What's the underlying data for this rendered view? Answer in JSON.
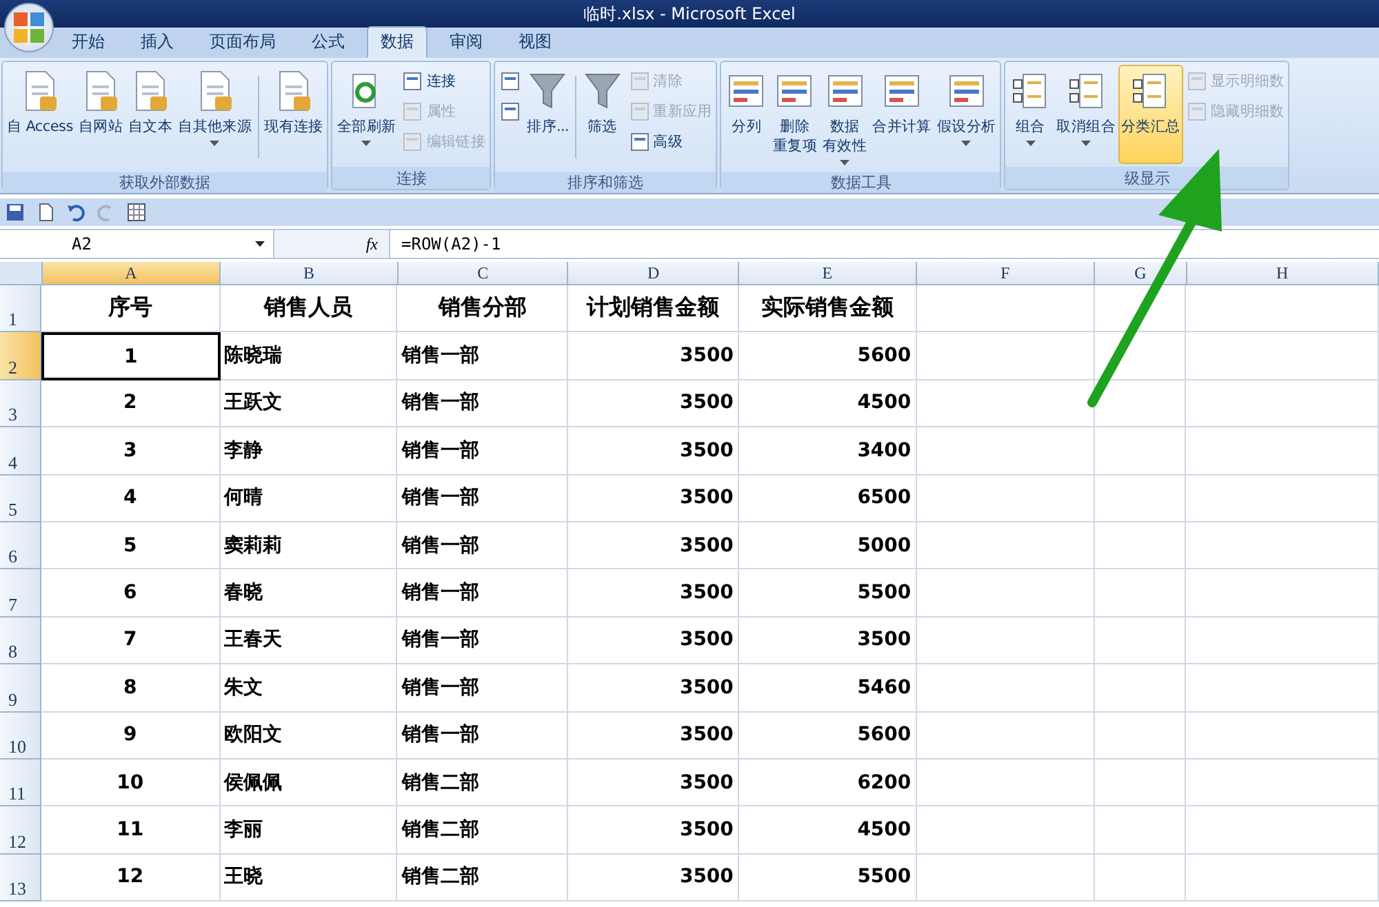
{
  "window": {
    "title": "临时.xlsx - Microsoft Excel"
  },
  "tabs": [
    {
      "label": "开始",
      "selected": false
    },
    {
      "label": "插入",
      "selected": false
    },
    {
      "label": "页面布局",
      "selected": false
    },
    {
      "label": "公式",
      "selected": false
    },
    {
      "label": "数据",
      "selected": true
    },
    {
      "label": "审阅",
      "selected": false
    },
    {
      "label": "视图",
      "selected": false
    }
  ],
  "ribbon_groups": [
    {
      "label": "获取外部数据",
      "items": [
        {
          "kind": "big",
          "label": "自 Access",
          "dropdown": false,
          "highlighted": false
        },
        {
          "kind": "big",
          "label": "自网站",
          "dropdown": false,
          "highlighted": false
        },
        {
          "kind": "big",
          "label": "自文本",
          "dropdown": false,
          "highlighted": false
        },
        {
          "kind": "big",
          "label": "自其他来源",
          "dropdown": true,
          "highlighted": false
        },
        {
          "kind": "separator"
        },
        {
          "kind": "big",
          "label": "现有连接",
          "dropdown": false,
          "highlighted": false
        }
      ]
    },
    {
      "label": "连接",
      "items": [
        {
          "kind": "big",
          "label": "全部刷新",
          "dropdown": true,
          "highlighted": false
        },
        {
          "kind": "stack",
          "buttons": [
            {
              "label": "连接",
              "disabled": false
            },
            {
              "label": "属性",
              "disabled": true
            },
            {
              "label": "编辑链接",
              "disabled": true
            }
          ]
        }
      ]
    },
    {
      "label": "排序和筛选",
      "items": [
        {
          "kind": "stack",
          "buttons": [
            {
              "disabled": false
            },
            {
              "disabled": false
            }
          ]
        },
        {
          "kind": "big",
          "label": "排序...",
          "dropdown": false,
          "highlighted": false
        },
        {
          "kind": "separator"
        },
        {
          "kind": "big",
          "label": "筛选",
          "dropdown": false,
          "highlighted": false
        },
        {
          "kind": "stack",
          "buttons": [
            {
              "label": "清除",
              "disabled": true
            },
            {
              "label": "重新应用",
              "disabled": true
            },
            {
              "label": "高级",
              "disabled": false
            }
          ]
        }
      ]
    },
    {
      "label": "数据工具",
      "items": [
        {
          "kind": "big",
          "label": "分列",
          "dropdown": false,
          "highlighted": false
        },
        {
          "kind": "big",
          "lines": [
            "删除",
            "重复项"
          ],
          "dropdown": false,
          "highlighted": false
        },
        {
          "kind": "big",
          "lines": [
            "数据",
            "有效性"
          ],
          "dropdown": true,
          "highlighted": false
        },
        {
          "kind": "big",
          "label": "合并计算",
          "dropdown": false,
          "highlighted": false
        },
        {
          "kind": "big",
          "label": "假设分析",
          "dropdown": true,
          "highlighted": false
        }
      ]
    },
    {
      "label": "级显示",
      "items": [
        {
          "kind": "big",
          "label": "组合",
          "dropdown": true,
          "highlighted": false
        },
        {
          "kind": "big",
          "label": "取消组合",
          "dropdown": true,
          "highlighted": false
        },
        {
          "kind": "big",
          "label": "分类汇总",
          "dropdown": false,
          "highlighted": true
        },
        {
          "kind": "stack",
          "buttons": [
            {
              "label": "显示明细数",
              "disabled": true
            },
            {
              "label": "隐藏明细数",
              "disabled": true
            }
          ]
        }
      ]
    }
  ],
  "formula_bar": {
    "name_box": "A2",
    "fx": "fx",
    "formula": "=ROW(A2)-1"
  },
  "columns": [
    {
      "label": "A",
      "selected": true
    },
    {
      "label": "B",
      "selected": false
    },
    {
      "label": "C",
      "selected": false
    },
    {
      "label": "D",
      "selected": false
    },
    {
      "label": "E",
      "selected": false
    },
    {
      "label": "F",
      "selected": false
    },
    {
      "label": "G",
      "selected": false
    },
    {
      "label": "H",
      "selected": false
    }
  ],
  "rows": [
    {
      "number": "1",
      "selected": false,
      "cells": [
        "序号",
        "销售人员",
        "销售分部",
        "计划销售金额",
        "实际销售金额"
      ]
    },
    {
      "number": "2",
      "selected": true,
      "cells": [
        "1",
        "陈晓瑞",
        "销售一部",
        "3500",
        "5600"
      ]
    },
    {
      "number": "3",
      "selected": false,
      "cells": [
        "2",
        "王跃文",
        "销售一部",
        "3500",
        "4500"
      ]
    },
    {
      "number": "4",
      "selected": false,
      "cells": [
        "3",
        "李静",
        "销售一部",
        "3500",
        "3400"
      ]
    },
    {
      "number": "5",
      "selected": false,
      "cells": [
        "4",
        "何晴",
        "销售一部",
        "3500",
        "6500"
      ]
    },
    {
      "number": "6",
      "selected": false,
      "cells": [
        "5",
        "窦莉莉",
        "销售一部",
        "3500",
        "5000"
      ]
    },
    {
      "number": "7",
      "selected": false,
      "cells": [
        "6",
        "春晓",
        "销售一部",
        "3500",
        "5500"
      ]
    },
    {
      "number": "8",
      "selected": false,
      "cells": [
        "7",
        "王春天",
        "销售一部",
        "3500",
        "3500"
      ]
    },
    {
      "number": "9",
      "selected": false,
      "cells": [
        "8",
        "朱文",
        "销售一部",
        "3500",
        "5460"
      ]
    },
    {
      "number": "10",
      "selected": false,
      "cells": [
        "9",
        "欧阳文",
        "销售一部",
        "3500",
        "5600"
      ]
    },
    {
      "number": "11",
      "selected": false,
      "cells": [
        "10",
        "侯佩佩",
        "销售二部",
        "3500",
        "6200"
      ]
    },
    {
      "number": "12",
      "selected": false,
      "cells": [
        "11",
        "李丽",
        "销售二部",
        "3500",
        "4500"
      ]
    },
    {
      "number": "13",
      "selected": false,
      "cells": [
        "12",
        "王晓",
        "销售二部",
        "3500",
        "5500"
      ]
    }
  ],
  "annotation": {
    "kind": "arrow"
  }
}
